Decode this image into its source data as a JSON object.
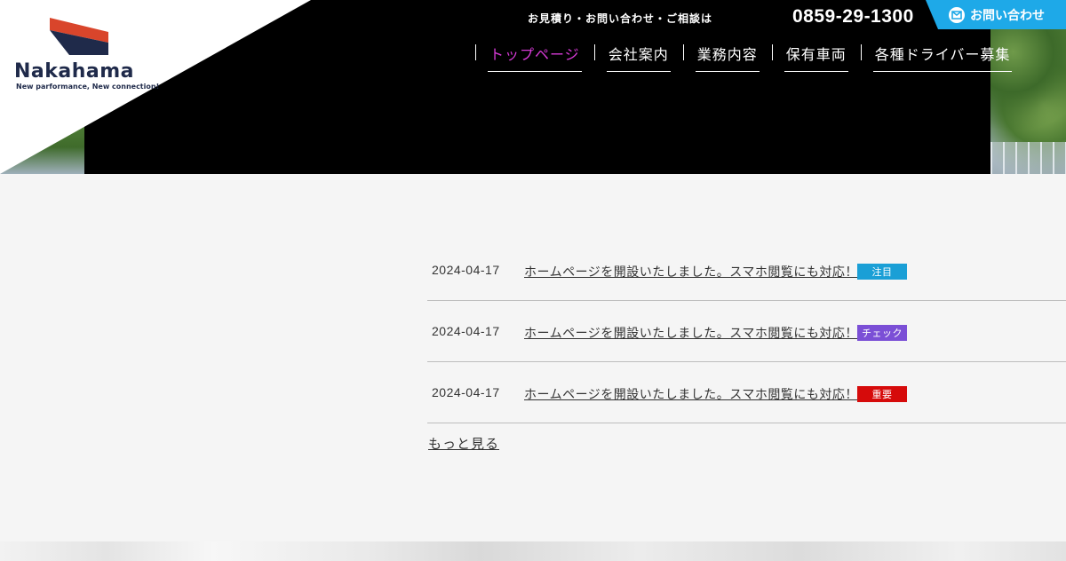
{
  "brand": {
    "name": "Nakahama",
    "tagline": "New parformance, New connection!"
  },
  "header": {
    "contact_text": "お見積り・お問い合わせ・ご相談は",
    "phone": "0859-29-1300",
    "inquiry_label": "お問い合わせ"
  },
  "nav": {
    "items": [
      {
        "label": "トップページ",
        "active": true
      },
      {
        "label": "会社案内"
      },
      {
        "label": "業務内容"
      },
      {
        "label": "保有車両"
      },
      {
        "label": "各種ドライバー募集"
      }
    ]
  },
  "news": {
    "items": [
      {
        "date": "2024-04-17",
        "title": "ホームページを開設いたしました。スマホ閲覧にも対応！",
        "tag": "注目",
        "tag_color": "#1a9fd6"
      },
      {
        "date": "2024-04-17",
        "title": "ホームページを開設いたしました。スマホ閲覧にも対応！",
        "tag": "チェック",
        "tag_color": "#7b4fd6"
      },
      {
        "date": "2024-04-17",
        "title": "ホームページを開設いたしました。スマホ閲覧にも対応！",
        "tag": "重要",
        "tag_color": "#d60b0b"
      }
    ],
    "more_label": "もっと見る"
  },
  "colors": {
    "accent": "#1ea9e8",
    "nav_active": "#d63ad6",
    "logo_navy": "#1f2a4a",
    "logo_red": "#d9452b"
  },
  "icons": {
    "inquiry": "mail-icon"
  }
}
